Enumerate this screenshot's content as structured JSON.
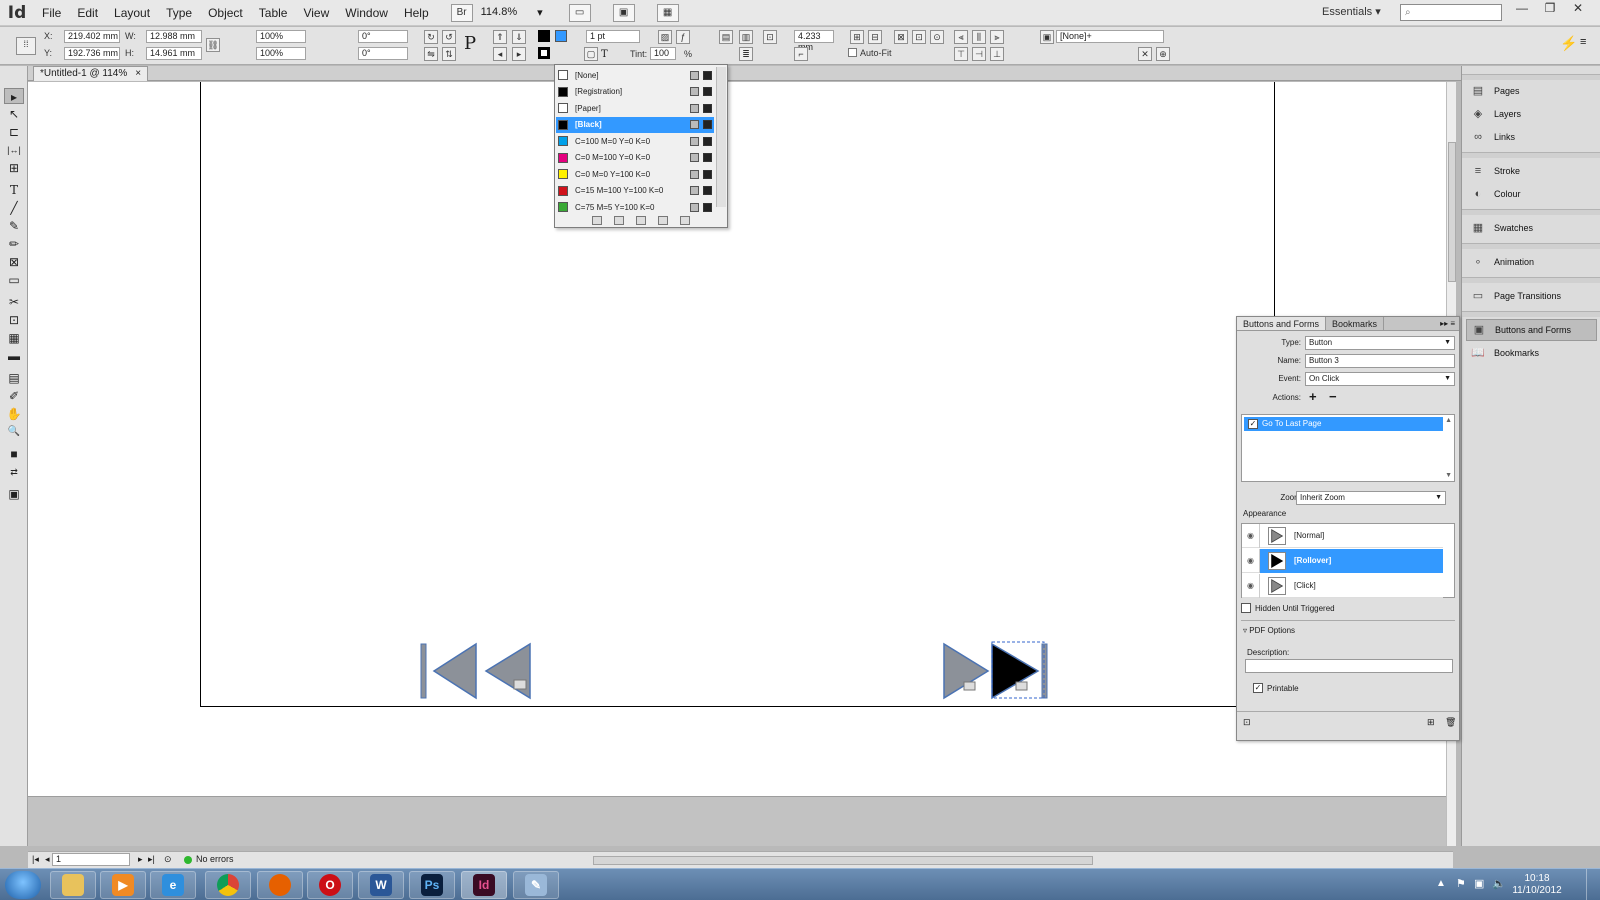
{
  "app": {
    "logo": "Id",
    "workspace": "Essentials"
  },
  "menu": [
    "File",
    "Edit",
    "Layout",
    "Type",
    "Object",
    "Table",
    "View",
    "Window",
    "Help"
  ],
  "menubar": {
    "zoom": "114.8%",
    "zoom_arrow": "▾",
    "workspace_arrow": "▾"
  },
  "window_controls": {
    "minimize": "—",
    "restore": "❐",
    "close": "✕"
  },
  "control": {
    "x_label": "X:",
    "x": "219.402 mm",
    "y_label": "Y:",
    "y": "192.736 mm",
    "w_label": "W:",
    "w": "12.988 mm",
    "h_label": "H:",
    "h": "14.961 mm",
    "scale_x": "100%",
    "scale_y": "100%",
    "rotate": "0°",
    "shear": "0°",
    "stroke_weight": "1 pt",
    "tint_label": "Tint:",
    "tint": "100",
    "tint_unit": "%",
    "text_wrap_offset": "4.233 mm",
    "autofit": "Auto-Fit",
    "object_style": "[None]+"
  },
  "document": {
    "tab": "*Untitled-1 @ 114%",
    "close": "×"
  },
  "tools": [
    "▸",
    "↖",
    "⊏",
    "|↔|",
    "⊞",
    "T",
    "╱",
    "✎",
    "✏",
    "⊠",
    "▭",
    "✂",
    "⊡",
    "▦",
    "▬",
    "▤",
    "✐",
    "✋",
    "🔍",
    "■",
    "⇄",
    "▣"
  ],
  "swatches": {
    "items": [
      {
        "name": "[None]",
        "color": "#ffffff"
      },
      {
        "name": "[Registration]",
        "color": "#000000"
      },
      {
        "name": "[Paper]",
        "color": "#ffffff"
      },
      {
        "name": "[Black]",
        "color": "#000000"
      },
      {
        "name": "C=100 M=0 Y=0 K=0",
        "color": "#00a0e9"
      },
      {
        "name": "C=0 M=100 Y=0 K=0",
        "color": "#e4007f"
      },
      {
        "name": "C=0 M=0 Y=100 K=0",
        "color": "#fff100"
      },
      {
        "name": "C=15 M=100 Y=100 K=0",
        "color": "#d0121b"
      },
      {
        "name": "C=75 M=5 Y=100 K=0",
        "color": "#3aa935"
      }
    ],
    "selected_index": 3
  },
  "dock": {
    "items": [
      "Pages",
      "Layers",
      "Links",
      "Stroke",
      "Colour",
      "Swatches",
      "Animation",
      "Page Transitions",
      "Buttons and Forms",
      "Bookmarks"
    ],
    "icons": [
      "▤",
      "◈",
      "∞",
      "≡",
      "◐",
      "▦",
      "∘",
      "▭",
      "▣",
      "📖"
    ],
    "active": "Buttons and Forms"
  },
  "buttons_forms": {
    "tabs": [
      "Buttons and Forms",
      "Bookmarks"
    ],
    "type_label": "Type:",
    "type": "Button",
    "name_label": "Name:",
    "name": "Button 3",
    "event_label": "Event:",
    "event": "On Click",
    "actions_label": "Actions:",
    "add_action": "+",
    "remove_action": "−",
    "action": "Go To Last Page",
    "zoom_label": "Zoom:",
    "zoom": "Inherit Zoom",
    "appearance_label": "Appearance",
    "states": [
      "[Normal]",
      "[Rollover]",
      "[Click]"
    ],
    "selected_state": "[Rollover]",
    "hidden_until_triggered": "Hidden Until Triggered",
    "pdf_options": "PDF Options",
    "description_label": "Description:",
    "printable": "Printable",
    "check_mark": "✓"
  },
  "status": {
    "page": "1",
    "preflight": "No errors"
  },
  "taskbar": {
    "time": "10:18",
    "date": "11/10/2012"
  }
}
